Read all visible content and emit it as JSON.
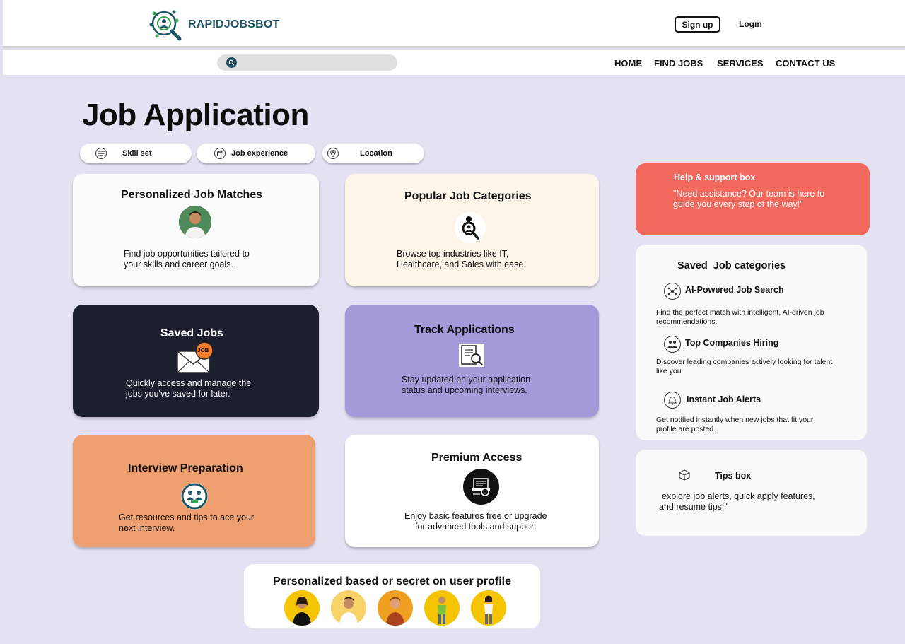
{
  "header": {
    "brand": "RAPIDJOBSBOT",
    "signup_label": "Sign up",
    "login_label": "Login"
  },
  "nav": {
    "search_placeholder": "",
    "items": [
      "HOME",
      "FIND JOBS",
      "SERVICES",
      "CONTACT US"
    ]
  },
  "page_title": "Job Application",
  "filters": [
    {
      "label": "Skill set",
      "icon": "list-icon"
    },
    {
      "label": "Job experience",
      "icon": "briefcase-icon"
    },
    {
      "label": "Location",
      "icon": "location-pin-icon"
    }
  ],
  "cards": {
    "matches": {
      "title": "Personalized Job Matches",
      "desc_line1": "Find job opportunities tailored to",
      "desc_line2": "your skills and career goals.",
      "bg": "#fcfcfc"
    },
    "categories": {
      "title": "Popular Job Categories",
      "desc_line1": "Browse top industries like IT,",
      "desc_line2": "Healthcare, and Sales with ease.",
      "bg": "#fdf4ea"
    },
    "saved": {
      "title": "Saved Jobs",
      "badge": "JOB",
      "desc_line1": "Quickly access and manage the",
      "desc_line2": "jobs you've saved for later.",
      "bg": "#1b1f2e"
    },
    "track": {
      "title": "Track Applications",
      "desc_line1": "Stay updated on your application",
      "desc_line2": "status and upcoming interviews.",
      "bg": "#a29ad9"
    },
    "interview": {
      "title": "Interview Preparation",
      "desc_line1": "Get resources and tips to ace your",
      "desc_line2": "next interview.",
      "bg": "#ee9f70"
    },
    "premium": {
      "title": "Premium Access",
      "desc_line1": "Enjoy basic features free or upgrade",
      "desc_line2": "for advanced tools and support",
      "bg": "#ffffff"
    }
  },
  "help_box": {
    "title": "Help & support box",
    "line1": "\"Need assistance? Our team is here to",
    "line2": "guide you every step of the way!\"",
    "bg": "#f0695c"
  },
  "saved_categories": {
    "title": "Saved  Job categories",
    "items": [
      {
        "title": "AI-Powered Job Search",
        "line1": "Find the perfect match with intelligent, AI-driven job",
        "line2": "recommendations."
      },
      {
        "title": "Top Companies Hiring",
        "line1": "Discover leading companies actively looking for talent",
        "line2": "like you."
      },
      {
        "title": "Instant Job Alerts",
        "line1": "Get notified instantly when new jobs that fit your",
        "line2": "profile are posted."
      }
    ]
  },
  "tips_box": {
    "title": "Tips box",
    "line1": "explore job alerts, quick apply features,",
    "line2": "and resume tips!\""
  },
  "profile_section": {
    "title": "Personalized based or secret on user profile",
    "avatar_colors": [
      "#f5c400",
      "#f7d36a",
      "#f0a020",
      "#f5c400",
      "#f5c400"
    ]
  },
  "colors": {
    "background": "#e3e1f2",
    "brand": "#1d5466",
    "accent_orange": "#f07b2a"
  }
}
